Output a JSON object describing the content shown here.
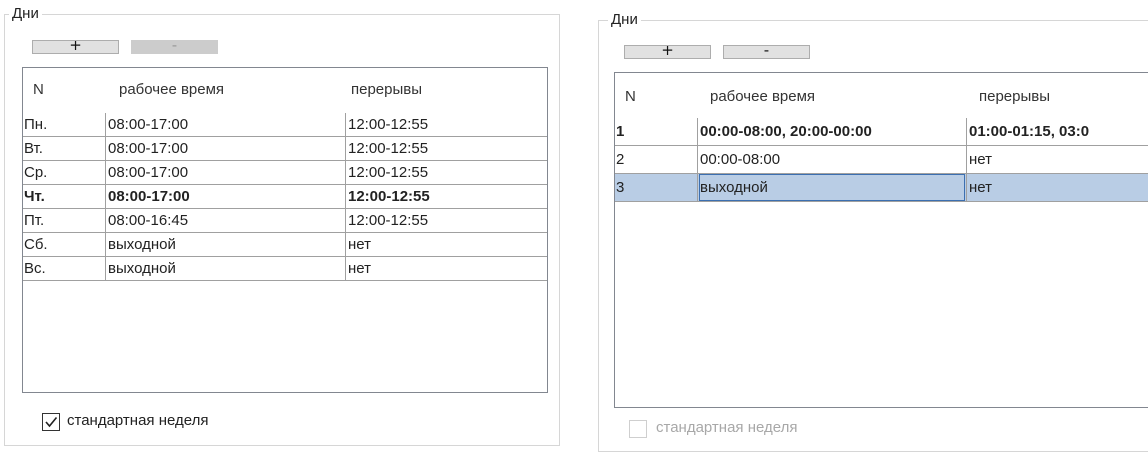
{
  "left": {
    "group_title": "Дни",
    "add_label": "+",
    "remove_label": "-",
    "columns": [
      "N",
      "рабочее время",
      "перерывы"
    ],
    "rows": [
      {
        "n": "Пн.",
        "work": "08:00-17:00",
        "breaks": "12:00-12:55"
      },
      {
        "n": "Вт.",
        "work": "08:00-17:00",
        "breaks": "12:00-12:55"
      },
      {
        "n": "Ср.",
        "work": "08:00-17:00",
        "breaks": "12:00-12:55"
      },
      {
        "n": "Чт.",
        "work": "08:00-17:00",
        "breaks": "12:00-12:55"
      },
      {
        "n": "Пт.",
        "work": "08:00-16:45",
        "breaks": "12:00-12:55"
      },
      {
        "n": "Сб.",
        "work": "выходной",
        "breaks": "нет"
      },
      {
        "n": "Вс.",
        "work": "выходной",
        "breaks": "нет"
      }
    ],
    "current_row": "Чт.",
    "standard_week_label": "стандартная неделя",
    "standard_week_checked": true
  },
  "right": {
    "group_title": "Дни",
    "add_label": "+",
    "remove_label": "-",
    "columns": [
      "N",
      "рабочее время",
      "перерывы"
    ],
    "rows": [
      {
        "n": "1",
        "work": "00:00-08:00, 20:00-00:00",
        "breaks": "01:00-01:15, 03:0"
      },
      {
        "n": "2",
        "work": "00:00-08:00",
        "breaks": "нет"
      },
      {
        "n": "3",
        "work": "выходной",
        "breaks": "нет"
      }
    ],
    "current_row": "1",
    "selected_row": "3",
    "standard_week_label": "стандартная неделя",
    "standard_week_checked": false
  },
  "colors": {
    "selection": "#b9cde5",
    "grid_line": "#a0a0a0",
    "disabled_text": "#a8a8a8"
  }
}
